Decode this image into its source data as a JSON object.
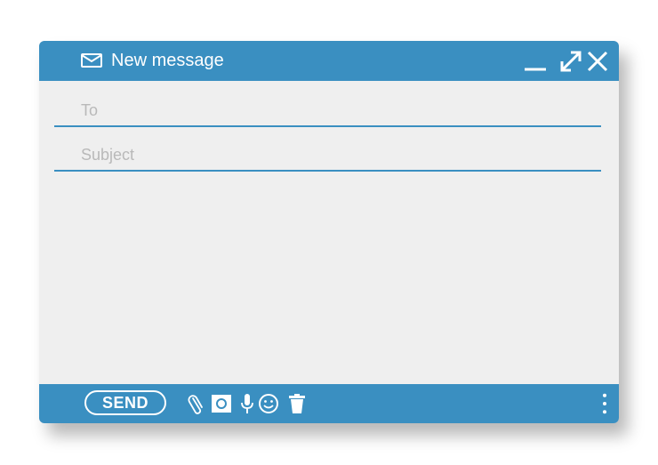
{
  "window": {
    "title": "New message",
    "accent_color": "#3a8fc1",
    "background_color": "#efefef"
  },
  "titlebar": {
    "icons": [
      "envelope-icon",
      "minimize-icon",
      "maximize-icon",
      "close-icon"
    ]
  },
  "fields": {
    "to_placeholder": "To",
    "subject_placeholder": "Subject",
    "to_value": "",
    "subject_value": ""
  },
  "footer": {
    "send_label": "SEND",
    "tools": [
      "paperclip-icon",
      "photo-icon",
      "microphone-icon",
      "emoji-icon",
      "trash-icon",
      "more-vertical-icon"
    ]
  }
}
